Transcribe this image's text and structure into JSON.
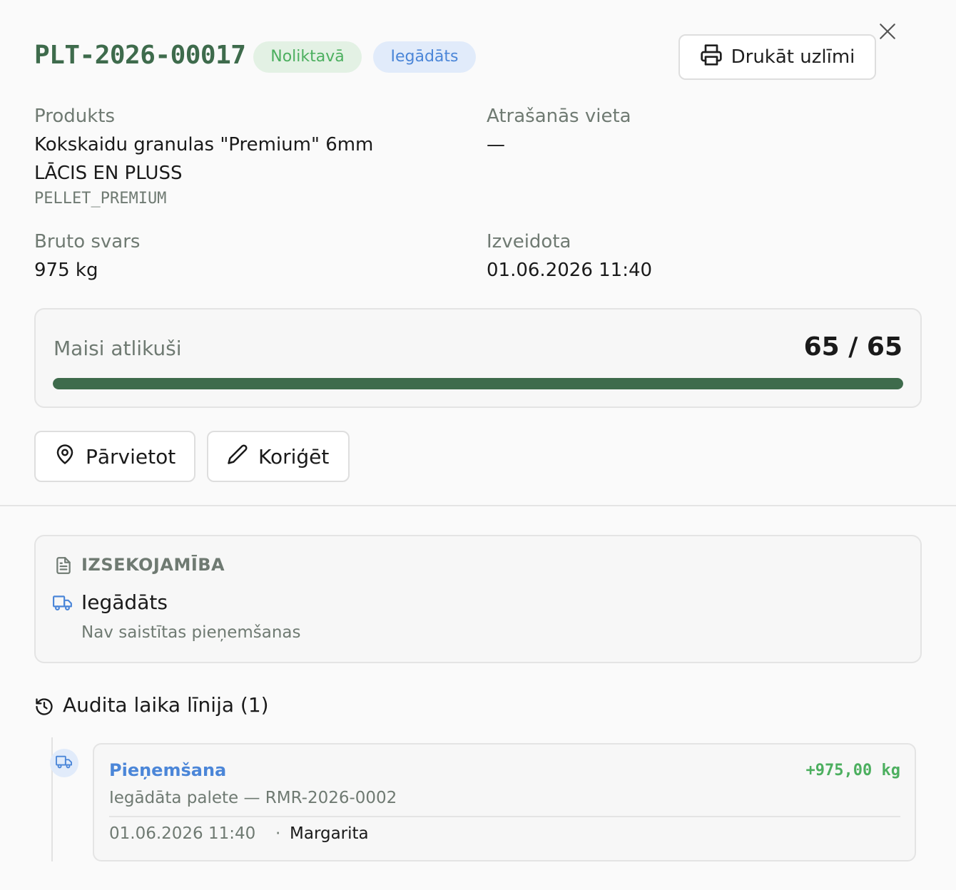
{
  "header": {
    "pallet_id": "PLT-2026-00017",
    "status_badge": "Noliktavā",
    "source_badge": "Iegādāts",
    "print_label": "Drukāt uzlīmi"
  },
  "product": {
    "label": "Produkts",
    "name_line1": "Kokskaidu granulas \"Premium\" 6mm",
    "name_line2": "LĀCIS EN PLUSS",
    "code": "PELLET_PREMIUM"
  },
  "location": {
    "label": "Atrašanās vieta",
    "value": "—"
  },
  "weight": {
    "label": "Bruto svars",
    "value": "975 kg"
  },
  "created": {
    "label": "Izveidota",
    "value": "01.06.2026 11:40"
  },
  "bags": {
    "label": "Maisi atlikuši",
    "count_text": "65 / 65",
    "remaining": 65,
    "total": 65
  },
  "actions": {
    "move_label": "Pārvietot",
    "correct_label": "Koriģēt"
  },
  "traceability": {
    "heading": "IZSEKOJAMĪBA",
    "type": "Iegādāts",
    "subtitle": "Nav saistītas pieņemšanas"
  },
  "audit": {
    "title": "Audita laika līnija (1)",
    "events": [
      {
        "title": "Pieņemšana",
        "amount": "+975,00 kg",
        "description": "Iegādāta palete — RMR-2026-0002",
        "time": "01.06.2026 11:40",
        "separator": "·",
        "user": "Margarita"
      }
    ]
  },
  "colors": {
    "brand_green": "#3e6b4c",
    "status_green": "#4caf5f",
    "info_blue": "#4b86d8"
  },
  "icons": {
    "print": "printer-icon",
    "close": "close-icon",
    "move": "map-pin-icon",
    "correct": "pencil-icon",
    "trace_heading": "document-icon",
    "trace_type": "truck-icon",
    "audit": "history-icon",
    "event": "truck-icon"
  }
}
